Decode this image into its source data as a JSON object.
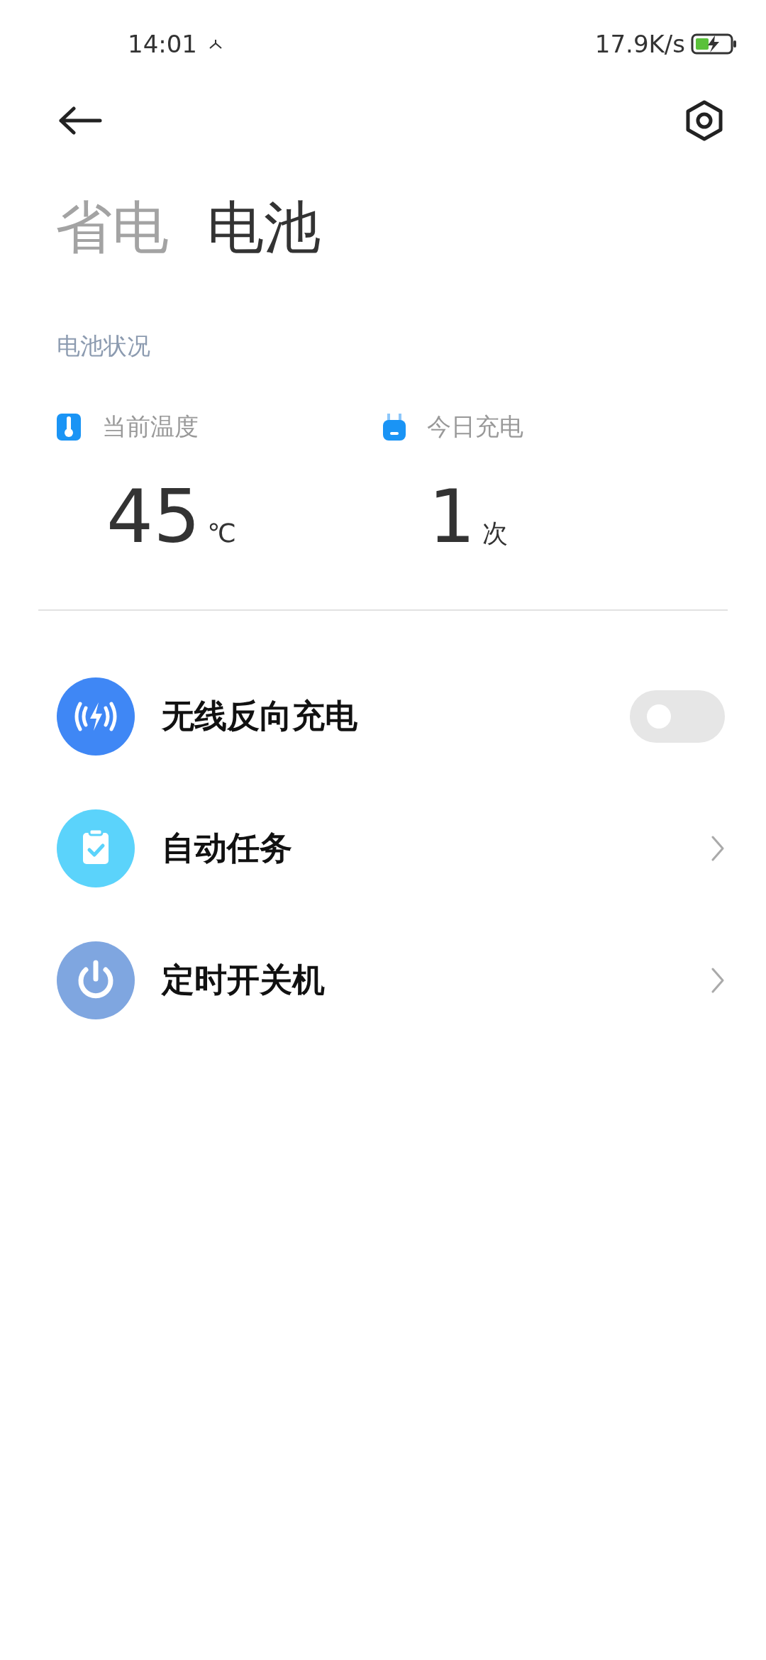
{
  "status_bar": {
    "time": "14:01",
    "net_speed": "17.9K/s"
  },
  "tabs": [
    {
      "label": "省电",
      "selected": false
    },
    {
      "label": "电池",
      "selected": true
    }
  ],
  "section_title": "电池状况",
  "stats": [
    {
      "label": "当前温度",
      "value": "45",
      "unit": "℃"
    },
    {
      "label": "今日充电",
      "value": "1",
      "unit": "次"
    }
  ],
  "items": [
    {
      "kind": "toggle",
      "label": "无线反向充电",
      "color": "#3f87f5",
      "checked": false
    },
    {
      "kind": "link",
      "label": "自动任务",
      "color": "#5bd3fb"
    },
    {
      "kind": "link",
      "label": "定时开关机",
      "color": "#7fa6e0"
    }
  ]
}
